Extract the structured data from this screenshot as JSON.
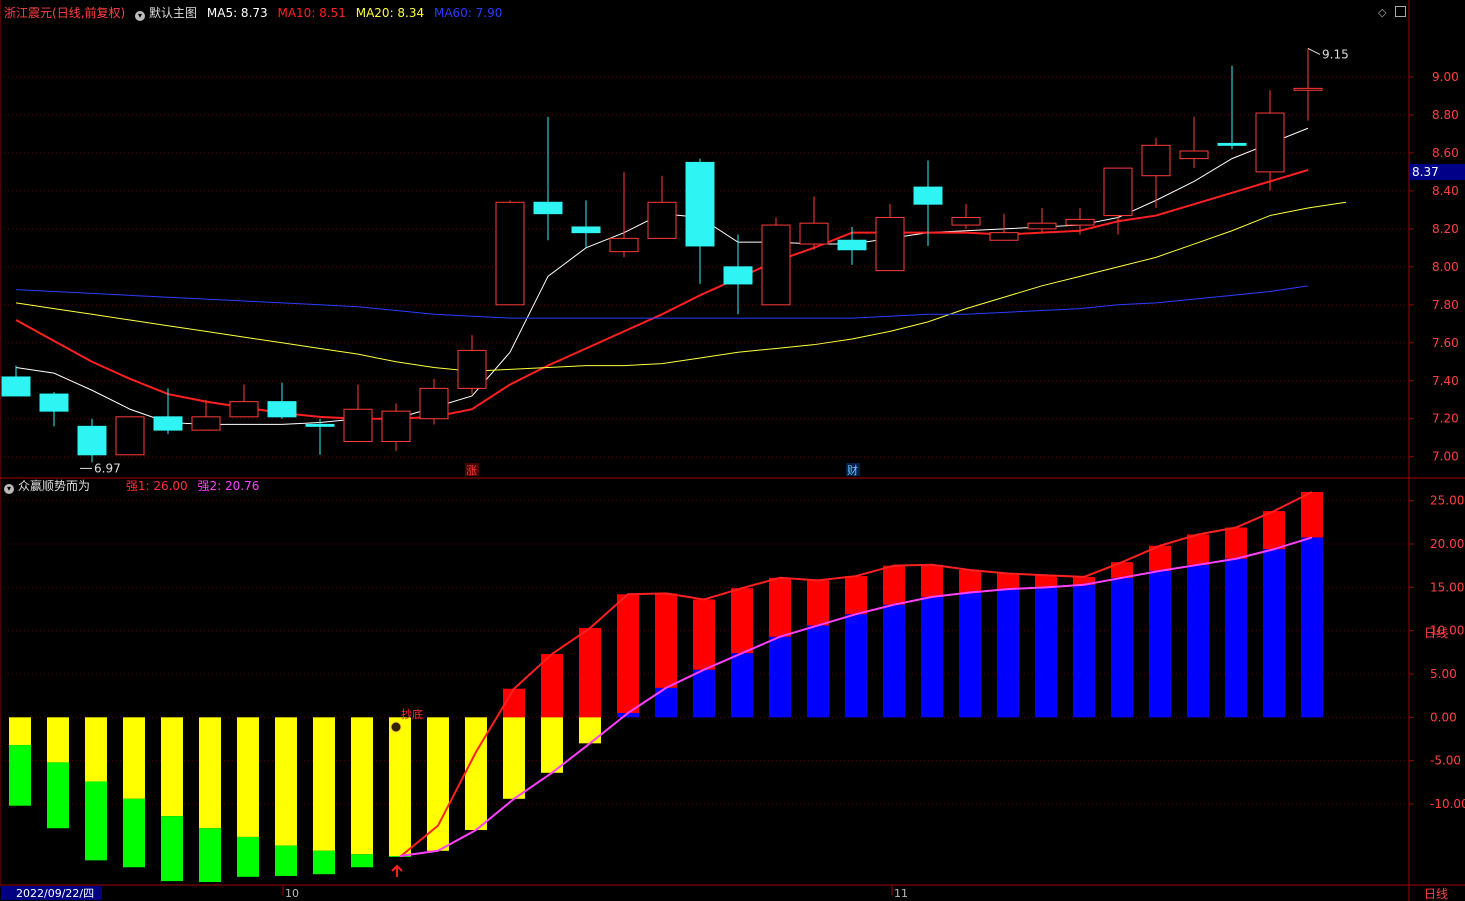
{
  "header": {
    "stock_name": "浙江震元",
    "period_mode": "(日线,前复权)",
    "main_chart_label": "默认主图",
    "ma_labels": [
      {
        "text": "MA5: 8.73",
        "color": "#ffffff"
      },
      {
        "text": "MA10: 8.51",
        "color": "#ff2020"
      },
      {
        "text": "MA20: 8.34",
        "color": "#ffff40"
      },
      {
        "text": "MA60: 7.90",
        "color": "#2a3cff"
      }
    ]
  },
  "indicator_header": {
    "name": "众赢顺势而为",
    "values": [
      {
        "text": "强1: 26.00",
        "color": "#ff3030"
      },
      {
        "text": "强2: 20.76",
        "color": "#ff40ff"
      }
    ]
  },
  "colors": {
    "up": "#ff3b3b",
    "down": "#2ef4f4",
    "frame": "#a00000",
    "axis_text": "#ff4040",
    "grid": "#a00000"
  },
  "price_axis": {
    "ticks": [
      "9.00",
      "8.80",
      "8.60",
      "8.40",
      "8.20",
      "8.00",
      "7.80",
      "7.60",
      "7.40",
      "7.20",
      "7.00"
    ],
    "current_price": "8.37"
  },
  "indicator_axis": {
    "ticks": [
      "25.00",
      "20.00",
      "15.00",
      "10.00",
      "5.00",
      "0.00",
      "-5.00",
      "-10.00"
    ]
  },
  "annotations": {
    "high_label": "9.15",
    "low_label": "6.97",
    "event_zhang": "涨",
    "event_cai": "财",
    "signal_label": "抄底"
  },
  "time_axis": {
    "start_date": "2022/09/22/四",
    "labels": [
      "10",
      "11"
    ],
    "period": "日线"
  },
  "chart_data": [
    {
      "type": "candlestick",
      "title": "浙江震元",
      "ylim": [
        6.93,
        9.3
      ],
      "candles": [
        {
          "o": 7.42,
          "h": 7.48,
          "l": 7.32,
          "c": 7.32
        },
        {
          "o": 7.33,
          "h": 7.34,
          "l": 7.16,
          "c": 7.24
        },
        {
          "o": 7.16,
          "h": 7.2,
          "l": 6.97,
          "c": 7.01
        },
        {
          "o": 7.01,
          "h": 7.21,
          "l": 7.01,
          "c": 7.21
        },
        {
          "o": 7.21,
          "h": 7.36,
          "l": 7.12,
          "c": 7.14
        },
        {
          "o": 7.14,
          "h": 7.3,
          "l": 7.14,
          "c": 7.21
        },
        {
          "o": 7.21,
          "h": 7.38,
          "l": 7.21,
          "c": 7.29
        },
        {
          "o": 7.29,
          "h": 7.39,
          "l": 7.2,
          "c": 7.21
        },
        {
          "o": 7.17,
          "h": 7.2,
          "l": 7.01,
          "c": 7.16
        },
        {
          "o": 7.08,
          "h": 7.38,
          "l": 7.08,
          "c": 7.25
        },
        {
          "o": 7.08,
          "h": 7.28,
          "l": 7.03,
          "c": 7.24
        },
        {
          "o": 7.2,
          "h": 7.41,
          "l": 7.17,
          "c": 7.36
        },
        {
          "o": 7.36,
          "h": 7.64,
          "l": 7.33,
          "c": 7.56
        },
        {
          "o": 7.8,
          "h": 8.35,
          "l": 7.8,
          "c": 8.34
        },
        {
          "o": 8.34,
          "h": 8.79,
          "l": 8.14,
          "c": 8.28
        },
        {
          "o": 8.21,
          "h": 8.35,
          "l": 8.1,
          "c": 8.18
        },
        {
          "o": 8.08,
          "h": 8.5,
          "l": 8.05,
          "c": 8.15
        },
        {
          "o": 8.15,
          "h": 8.48,
          "l": 8.15,
          "c": 8.34
        },
        {
          "o": 8.55,
          "h": 8.57,
          "l": 7.91,
          "c": 8.11
        },
        {
          "o": 8.0,
          "h": 8.17,
          "l": 7.75,
          "c": 7.91
        },
        {
          "o": 7.8,
          "h": 8.26,
          "l": 7.8,
          "c": 8.22
        },
        {
          "o": 8.12,
          "h": 8.37,
          "l": 8.09,
          "c": 8.23
        },
        {
          "o": 8.14,
          "h": 8.21,
          "l": 8.01,
          "c": 8.09
        },
        {
          "o": 7.98,
          "h": 8.33,
          "l": 7.98,
          "c": 8.26
        },
        {
          "o": 8.42,
          "h": 8.56,
          "l": 8.11,
          "c": 8.33
        },
        {
          "o": 8.22,
          "h": 8.33,
          "l": 8.2,
          "c": 8.26
        },
        {
          "o": 8.14,
          "h": 8.28,
          "l": 8.14,
          "c": 8.18
        },
        {
          "o": 8.2,
          "h": 8.31,
          "l": 8.18,
          "c": 8.23
        },
        {
          "o": 8.22,
          "h": 8.31,
          "l": 8.17,
          "c": 8.25
        },
        {
          "o": 8.27,
          "h": 8.52,
          "l": 8.17,
          "c": 8.52
        },
        {
          "o": 8.48,
          "h": 8.68,
          "l": 8.31,
          "c": 8.64
        },
        {
          "o": 8.57,
          "h": 8.79,
          "l": 8.52,
          "c": 8.61
        },
        {
          "o": 8.65,
          "h": 9.06,
          "l": 8.62,
          "c": 8.64
        },
        {
          "o": 8.5,
          "h": 8.93,
          "l": 8.4,
          "c": 8.81
        },
        {
          "o": 8.93,
          "h": 9.15,
          "l": 8.77,
          "c": 8.94
        }
      ],
      "series": [
        {
          "name": "MA5",
          "color": "#ffffff",
          "values": [
            7.47,
            7.44,
            7.35,
            7.25,
            7.18,
            7.17,
            7.17,
            7.17,
            7.18,
            7.2,
            7.2,
            7.26,
            7.32,
            7.55,
            7.95,
            8.1,
            8.18,
            8.28,
            8.26,
            8.13,
            8.13,
            8.12,
            8.12,
            8.15,
            8.18,
            8.19,
            8.2,
            8.21,
            8.22,
            8.26,
            8.35,
            8.45,
            8.57,
            8.65,
            8.73
          ]
        },
        {
          "name": "MA10",
          "color": "#ff2020",
          "values": [
            7.72,
            7.61,
            7.5,
            7.41,
            7.33,
            7.29,
            7.26,
            7.23,
            7.21,
            7.2,
            7.2,
            7.21,
            7.25,
            7.38,
            7.48,
            7.57,
            7.66,
            7.75,
            7.85,
            7.94,
            8.03,
            8.1,
            8.18,
            8.18,
            8.18,
            8.18,
            8.17,
            8.18,
            8.19,
            8.24,
            8.27,
            8.33,
            8.39,
            8.45,
            8.51
          ]
        },
        {
          "name": "MA20",
          "color": "#ffff40",
          "values": [
            7.81,
            7.78,
            7.75,
            7.72,
            7.69,
            7.66,
            7.63,
            7.6,
            7.57,
            7.54,
            7.5,
            7.47,
            7.45,
            7.46,
            7.47,
            7.48,
            7.48,
            7.49,
            7.52,
            7.55,
            7.57,
            7.59,
            7.62,
            7.66,
            7.71,
            7.78,
            7.84,
            7.9,
            7.95,
            8.0,
            8.05,
            8.12,
            8.19,
            8.27,
            8.31,
            8.34
          ]
        },
        {
          "name": "MA60",
          "color": "#2a3cff",
          "values": [
            7.88,
            7.87,
            7.86,
            7.85,
            7.84,
            7.83,
            7.82,
            7.81,
            7.8,
            7.79,
            7.77,
            7.75,
            7.74,
            7.73,
            7.73,
            7.73,
            7.73,
            7.73,
            7.73,
            7.73,
            7.73,
            7.73,
            7.73,
            7.74,
            7.75,
            7.75,
            7.76,
            7.77,
            7.78,
            7.8,
            7.81,
            7.83,
            7.85,
            7.87,
            7.9
          ]
        }
      ]
    },
    {
      "type": "bar",
      "title": "众赢顺势而为",
      "ylim": [
        -19,
        26
      ],
      "bars": [
        {
          "base": -3.2,
          "over": -10.2
        },
        {
          "base": -5.2,
          "over": -12.8
        },
        {
          "base": -7.4,
          "over": -16.5
        },
        {
          "base": -9.4,
          "over": -17.3
        },
        {
          "base": -11.4,
          "over": -18.9
        },
        {
          "base": -12.8,
          "over": -19.0
        },
        {
          "base": -13.8,
          "over": -18.4
        },
        {
          "base": -14.8,
          "over": -18.3
        },
        {
          "base": -15.4,
          "over": -18.1
        },
        {
          "base": -15.8,
          "over": -17.3
        },
        {
          "base": -16.0,
          "over": -16.1
        },
        {
          "base": -15.4,
          "over": -14.9
        },
        {
          "base": -13.0,
          "over": -8.7
        },
        {
          "base": -9.4,
          "over": 3.3
        },
        {
          "base": -6.4,
          "over": 7.3
        },
        {
          "base": -3.0,
          "over": 10.3
        },
        {
          "base": 0.5,
          "over": 14.2
        },
        {
          "base": 3.4,
          "over": 14.3
        },
        {
          "base": 5.5,
          "over": 13.6
        },
        {
          "base": 7.4,
          "over": 14.9
        },
        {
          "base": 9.3,
          "over": 16.1
        },
        {
          "base": 10.6,
          "over": 15.8
        },
        {
          "base": 11.9,
          "over": 16.3
        },
        {
          "base": 13.0,
          "over": 17.5
        },
        {
          "base": 13.9,
          "over": 17.6
        },
        {
          "base": 14.4,
          "over": 17.0
        },
        {
          "base": 14.8,
          "over": 16.6
        },
        {
          "base": 15.0,
          "over": 16.4
        },
        {
          "base": 15.3,
          "over": 16.2
        },
        {
          "base": 16.1,
          "over": 17.9
        },
        {
          "base": 16.9,
          "over": 19.8
        },
        {
          "base": 17.6,
          "over": 21.1
        },
        {
          "base": 18.3,
          "over": 21.9
        },
        {
          "base": 19.4,
          "over": 23.8
        },
        {
          "base": 20.76,
          "over": 26.0
        }
      ],
      "series": [
        {
          "name": "强1",
          "color": "#ff2020",
          "values": [
            null,
            null,
            null,
            null,
            null,
            null,
            null,
            null,
            null,
            null,
            -16.1,
            -12.5,
            -4.0,
            3.3,
            7.3,
            10.3,
            14.2,
            14.3,
            13.6,
            14.9,
            16.1,
            15.8,
            16.3,
            17.5,
            17.6,
            17.0,
            16.6,
            16.4,
            16.2,
            17.9,
            19.8,
            21.1,
            21.9,
            23.8,
            26.0
          ]
        },
        {
          "name": "强2",
          "color": "#ff40ff",
          "values": [
            null,
            null,
            null,
            null,
            null,
            null,
            null,
            null,
            null,
            null,
            -16.0,
            -15.4,
            -13.0,
            -9.4,
            -6.4,
            -3.0,
            0.5,
            3.4,
            5.5,
            7.4,
            9.3,
            10.6,
            11.9,
            13.0,
            13.9,
            14.4,
            14.8,
            15.0,
            15.3,
            16.1,
            16.9,
            17.6,
            18.3,
            19.4,
            20.76
          ]
        }
      ]
    }
  ]
}
